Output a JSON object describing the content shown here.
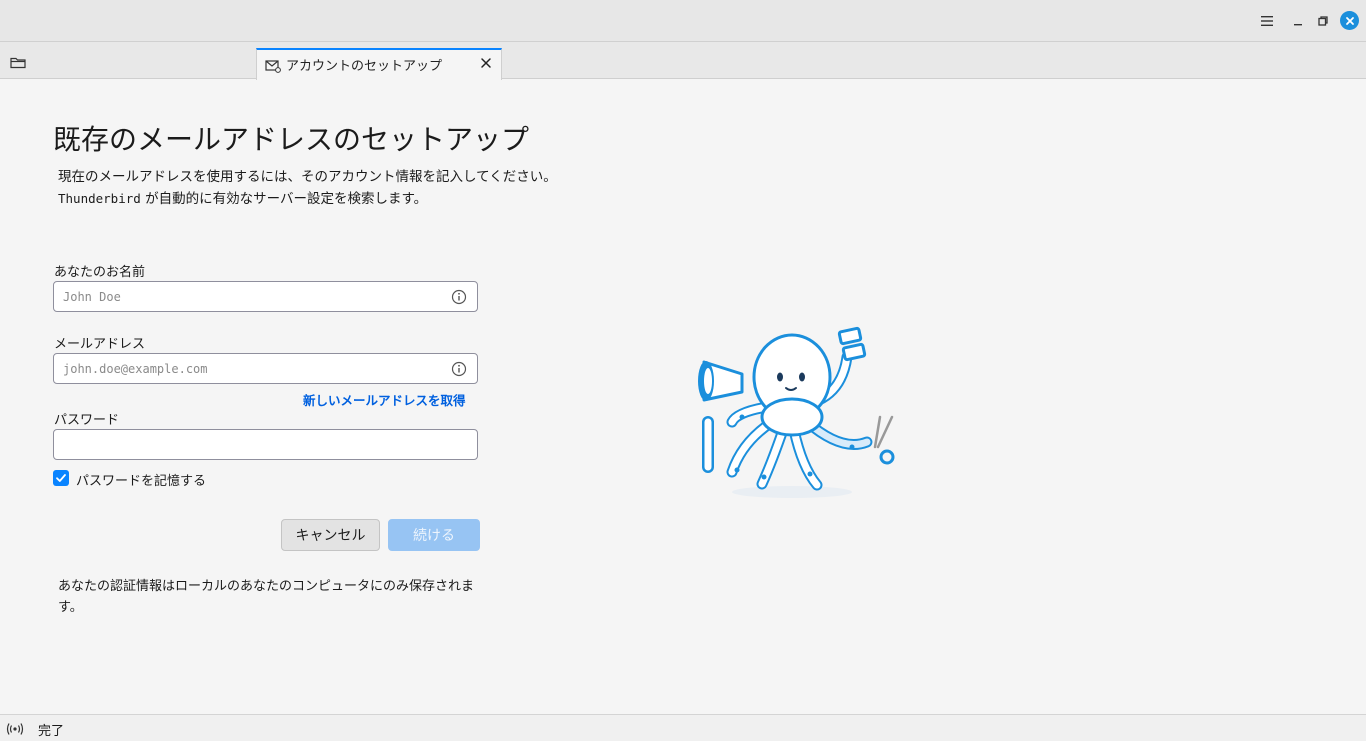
{
  "tab": {
    "label": "アカウントのセットアップ"
  },
  "page": {
    "title": "既存のメールアドレスのセットアップ",
    "intro_line1": "現在のメールアドレスを使用するには、そのアカウント情報を記入してください。",
    "intro_line2_app": "Thunderbird",
    "intro_line2_rest": " が自動的に有効なサーバー設定を検索します。"
  },
  "form": {
    "name_label": "あなたのお名前",
    "name_placeholder": "John Doe",
    "email_label": "メールアドレス",
    "email_placeholder": "john.doe@example.com",
    "new_email_link": "新しいメールアドレスを取得",
    "password_label": "パスワード",
    "password_value": "",
    "remember_label": "パスワードを記憶する",
    "remember_checked": true,
    "cancel_label": "キャンセル",
    "continue_label": "続ける",
    "footnote": "あなたの認証情報はローカルのあなたのコンピュータにのみ保存されます。"
  },
  "status": {
    "text": "完了"
  },
  "icons": {
    "menu": "hamburger-menu-icon",
    "minimize": "minimize-icon",
    "maximize": "restore-icon",
    "close": "close-icon",
    "folder": "folder-icon",
    "tab": "mail-setup-icon",
    "info": "info-icon",
    "status": "online-status-icon"
  },
  "colors": {
    "accent": "#0a84ff",
    "link": "#0060df",
    "close_button": "#1b8fdc",
    "disabled_primary": "#97c4f3"
  }
}
